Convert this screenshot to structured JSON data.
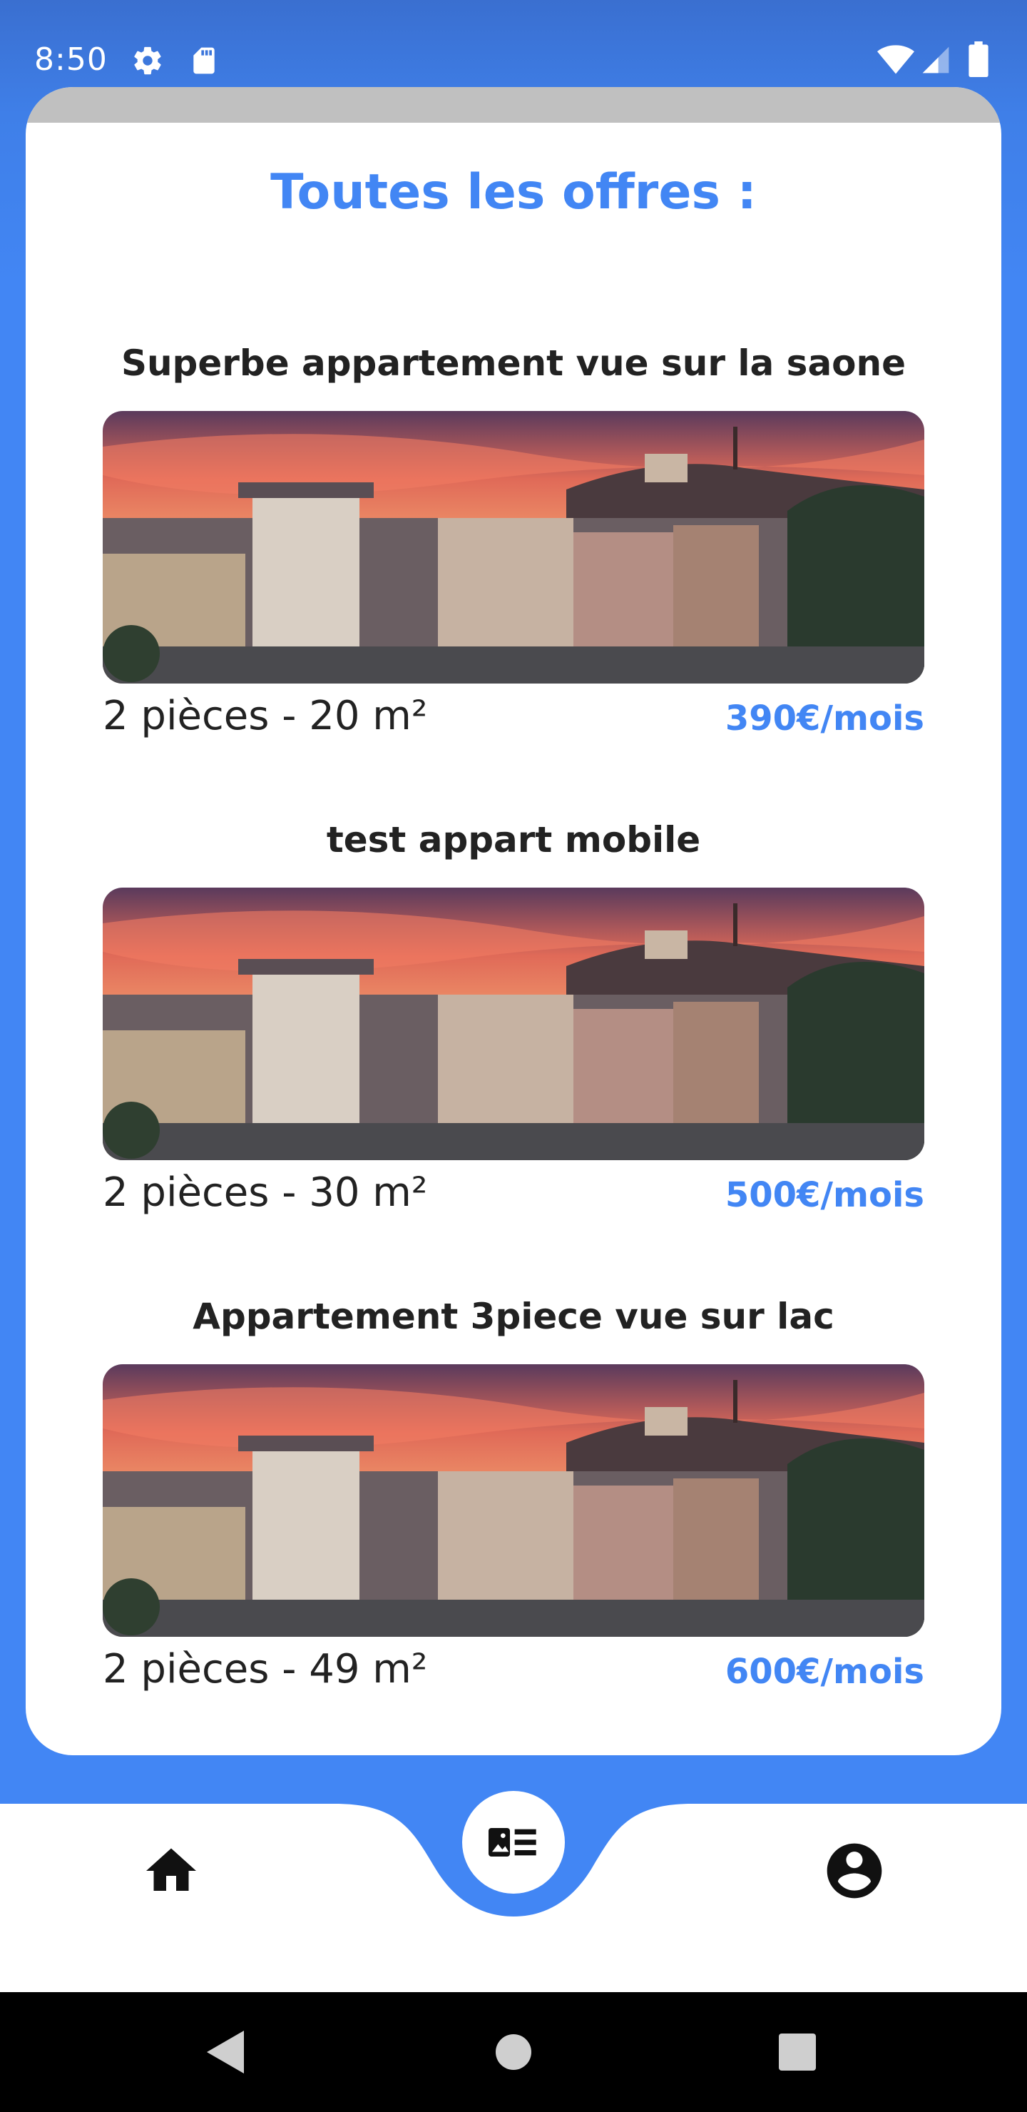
{
  "status_bar": {
    "time": "8:50",
    "icons": [
      "settings-icon",
      "sd-card-icon",
      "wifi-icon",
      "signal-icon",
      "battery-icon"
    ]
  },
  "page": {
    "title": "Toutes les offres :"
  },
  "listings": [
    {
      "title": "Superbe appartement vue sur la saone",
      "details": "2 pièces - 20 m²",
      "price": "390€/mois"
    },
    {
      "title": "test appart mobile",
      "details": "2 pièces - 30 m²",
      "price": "500€/mois"
    },
    {
      "title": "Appartement 3piece vue sur lac",
      "details": "2 pièces - 49 m²",
      "price": "600€/mois"
    }
  ],
  "bottom_nav": {
    "items": [
      "home-icon",
      "listings-icon",
      "account-icon"
    ],
    "active": "listings-icon"
  },
  "colors": {
    "accent": "#4286f4",
    "status_bar": "#3a6fd0",
    "text": "#222222"
  }
}
